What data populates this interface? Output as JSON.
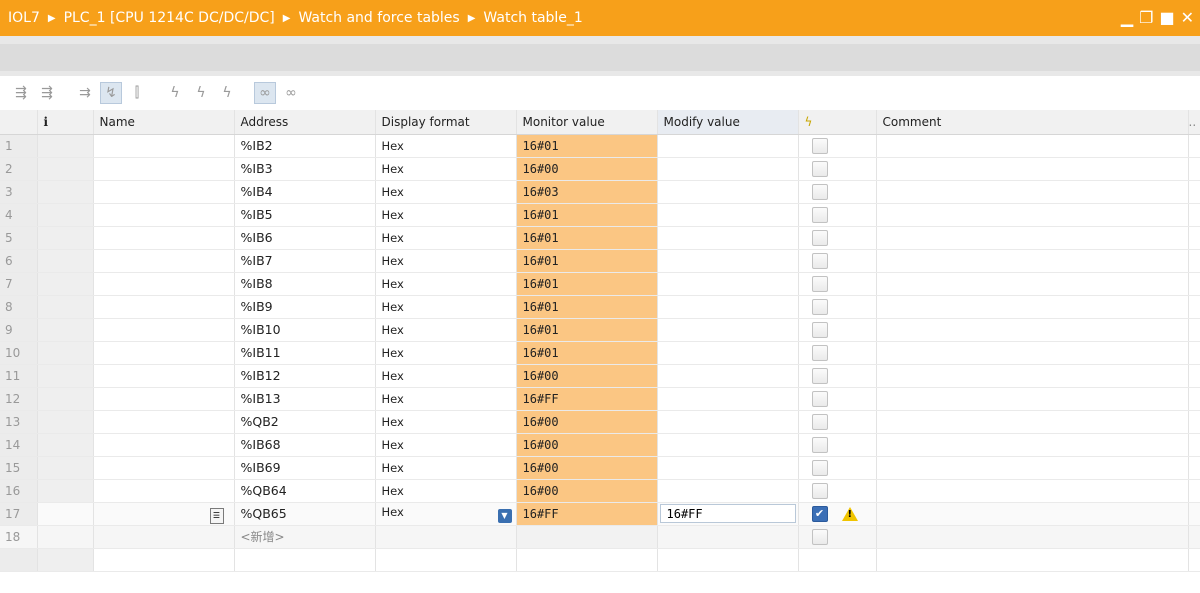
{
  "breadcrumb": [
    "IOL7",
    "PLC_1 [CPU 1214C DC/DC/DC]",
    "Watch and force tables",
    "Watch table_1"
  ],
  "columns": {
    "info": "i",
    "name": "Name",
    "address": "Address",
    "format": "Display format",
    "monitor": "Monitor value",
    "modify": "Modify value",
    "comment": "Comment"
  },
  "rows": [
    {
      "n": "1",
      "address": "%IB2",
      "format": "Hex",
      "monitor": "16#01"
    },
    {
      "n": "2",
      "address": "%IB3",
      "format": "Hex",
      "monitor": "16#00"
    },
    {
      "n": "3",
      "address": "%IB4",
      "format": "Hex",
      "monitor": "16#03"
    },
    {
      "n": "4",
      "address": "%IB5",
      "format": "Hex",
      "monitor": "16#01"
    },
    {
      "n": "5",
      "address": "%IB6",
      "format": "Hex",
      "monitor": "16#01"
    },
    {
      "n": "6",
      "address": "%IB7",
      "format": "Hex",
      "monitor": "16#01"
    },
    {
      "n": "7",
      "address": "%IB8",
      "format": "Hex",
      "monitor": "16#01"
    },
    {
      "n": "8",
      "address": "%IB9",
      "format": "Hex",
      "monitor": "16#01"
    },
    {
      "n": "9",
      "address": "%IB10",
      "format": "Hex",
      "monitor": "16#01"
    },
    {
      "n": "10",
      "address": "%IB11",
      "format": "Hex",
      "monitor": "16#01"
    },
    {
      "n": "11",
      "address": "%IB12",
      "format": "Hex",
      "monitor": "16#00"
    },
    {
      "n": "12",
      "address": "%IB13",
      "format": "Hex",
      "monitor": "16#FF"
    },
    {
      "n": "13",
      "address": "%QB2",
      "format": "Hex",
      "monitor": "16#00"
    },
    {
      "n": "14",
      "address": "%IB68",
      "format": "Hex",
      "monitor": "16#00"
    },
    {
      "n": "15",
      "address": "%IB69",
      "format": "Hex",
      "monitor": "16#00"
    },
    {
      "n": "16",
      "address": "%QB64",
      "format": "Hex",
      "monitor": "16#00"
    }
  ],
  "active_row": {
    "n": "17",
    "address": "%QB65",
    "format": "Hex",
    "monitor": "16#FF",
    "modify": "16#FF",
    "checked": true
  },
  "new_row": {
    "n": "18",
    "placeholder": "<新增>"
  },
  "colors": {
    "titlebar": "#f7a01a",
    "monitor_cell": "#fbc683",
    "checkbox_on": "#3b6fb6",
    "warning": "#f0c400"
  }
}
